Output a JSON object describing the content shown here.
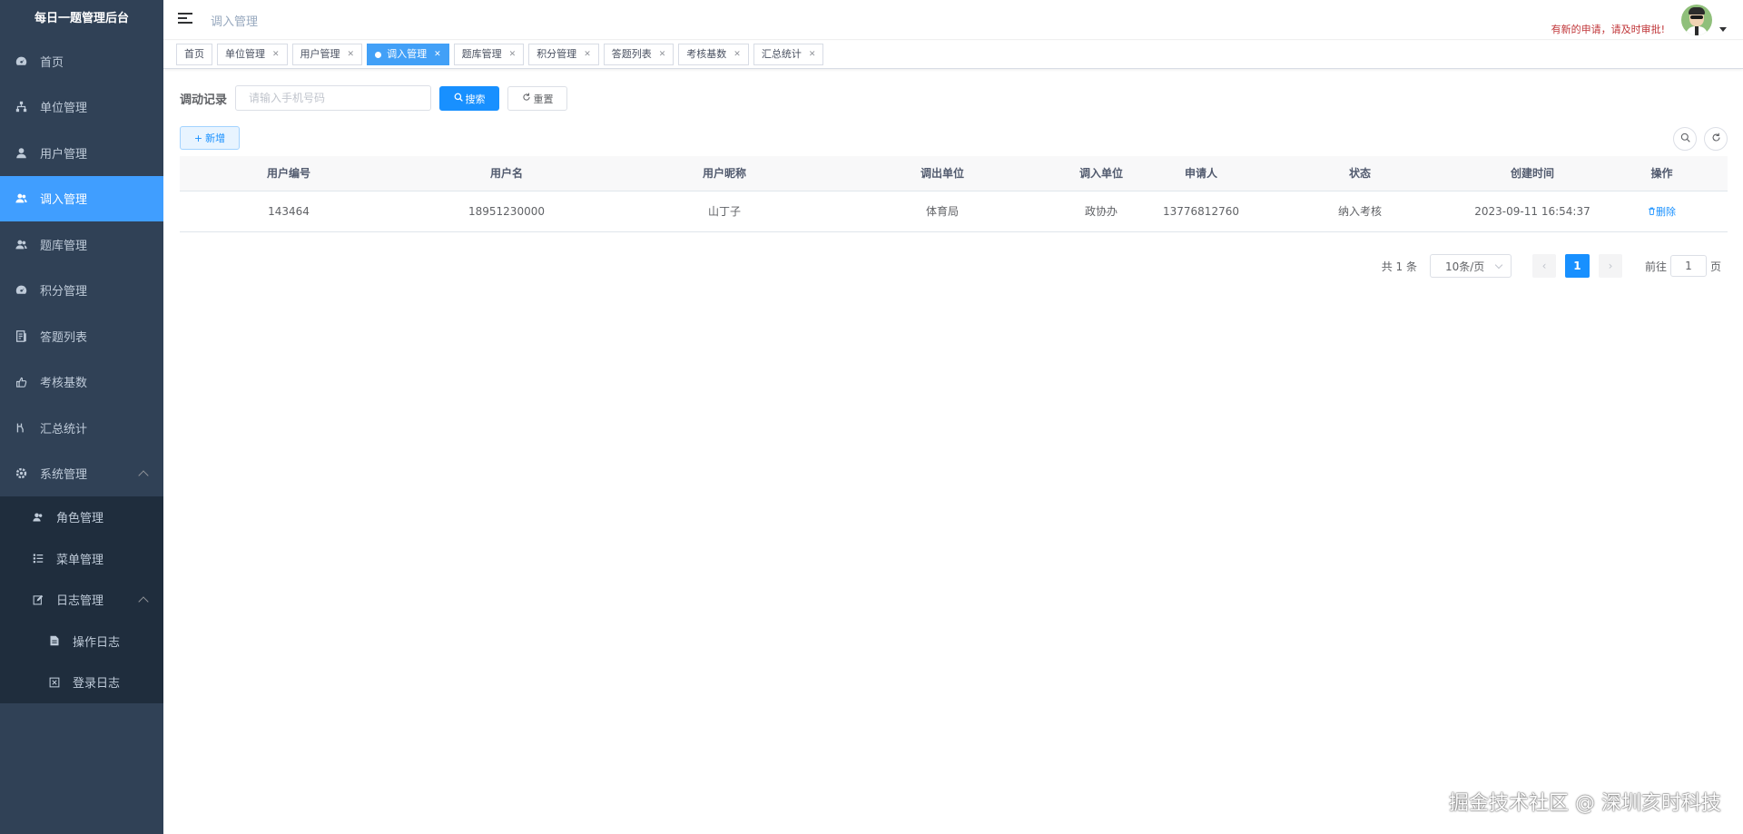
{
  "sidebar": {
    "title": "每日一题管理后台",
    "items": [
      {
        "label": "首页",
        "icon": "dashboard-icon"
      },
      {
        "label": "单位管理",
        "icon": "tree-icon"
      },
      {
        "label": "用户管理",
        "icon": "user-icon"
      },
      {
        "label": "调入管理",
        "icon": "peoples-icon"
      },
      {
        "label": "题库管理",
        "icon": "peoples-icon"
      },
      {
        "label": "积分管理",
        "icon": "dashboard-icon"
      },
      {
        "label": "答题列表",
        "icon": "list-icon"
      },
      {
        "label": "考核基数",
        "icon": "hand-icon"
      },
      {
        "label": "汇总统计",
        "icon": "chart-icon"
      },
      {
        "label": "系统管理",
        "icon": "gear-icon"
      }
    ],
    "system_children": [
      {
        "label": "角色管理",
        "icon": "peoples-icon"
      },
      {
        "label": "菜单管理",
        "icon": "tree-table-icon"
      },
      {
        "label": "日志管理",
        "icon": "edit-icon"
      }
    ],
    "log_children": [
      {
        "label": "操作日志",
        "icon": "form-icon"
      },
      {
        "label": "登录日志",
        "icon": "login-info-icon"
      }
    ]
  },
  "header": {
    "breadcrumb": "调入管理",
    "notice": "有新的申请，请及时审批!"
  },
  "tags": [
    {
      "label": "首页",
      "closable": false
    },
    {
      "label": "单位管理",
      "closable": true
    },
    {
      "label": "用户管理",
      "closable": true
    },
    {
      "label": "调入管理",
      "closable": true,
      "active": true
    },
    {
      "label": "题库管理",
      "closable": true
    },
    {
      "label": "积分管理",
      "closable": true
    },
    {
      "label": "答题列表",
      "closable": true
    },
    {
      "label": "考核基数",
      "closable": true
    },
    {
      "label": "汇总统计",
      "closable": true
    }
  ],
  "search": {
    "label": "调动记录",
    "placeholder": "请输入手机号码",
    "search_btn": "搜索",
    "reset_btn": "重置",
    "add_btn": "新增"
  },
  "table": {
    "headers": [
      "用户编号",
      "用户名",
      "用户昵称",
      "调出单位",
      "调入单位",
      "申请人",
      "状态",
      "创建时间",
      "操作"
    ],
    "rows": [
      {
        "id": "143464",
        "username": "18951230000",
        "nickname": "山丁子",
        "out_unit": "体育局",
        "in_unit": "政协办",
        "applicant": "13776812760",
        "status": "纳入考核",
        "created": "2023-09-11 16:54:37",
        "action": "删除"
      }
    ]
  },
  "pagination": {
    "total_text": "共 1 条",
    "page_size": "10条/页",
    "current_page": "1",
    "goto_prefix": "前往",
    "goto_value": "1",
    "goto_suffix": "页"
  },
  "watermark": "掘金技术社区 @ 深圳亥时科技",
  "colors": {
    "sidebar_bg": "#304156",
    "submenu_bg": "#1f2d3d",
    "primary": "#1890ff",
    "active_menu": "#409eff",
    "notice": "#c03639"
  }
}
